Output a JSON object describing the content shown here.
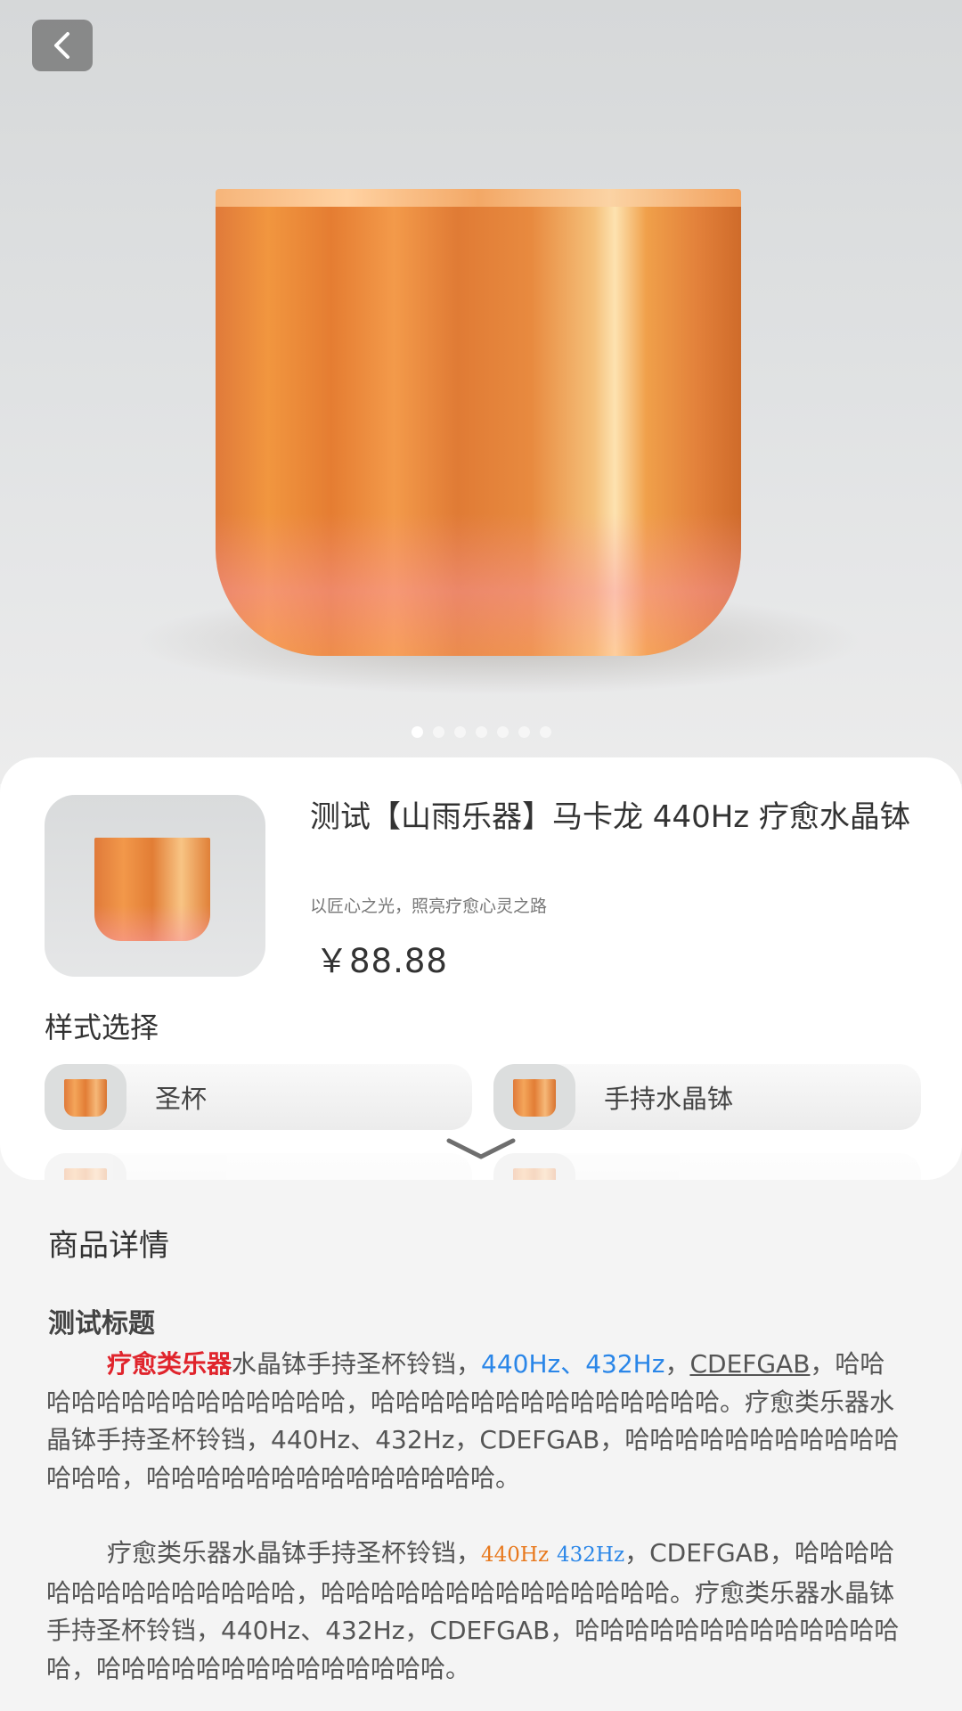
{
  "hero": {
    "image": "orange-crystal-singing-bowl",
    "carousel": {
      "count": 7,
      "active_index": 0
    }
  },
  "nav": {
    "back_icon": "chevron-left-icon"
  },
  "product": {
    "title": "测试【山雨乐器】马卡龙 440Hz 疗愈水晶钵",
    "subtitle": "以匠心之光，照亮疗愈心灵之路",
    "price": "￥88.88"
  },
  "styles": {
    "heading": "样式选择",
    "options": [
      {
        "label": "圣杯"
      },
      {
        "label": "手持水晶钵"
      }
    ],
    "expand_icon": "chevron-down-icon"
  },
  "details": {
    "heading": "商品详情",
    "title": "测试标题",
    "para1": {
      "red": "疗愈类乐器",
      "text1": "水晶钵手持圣杯铃铛，",
      "blue": "440Hz、432Hz",
      "sep": "，",
      "underline": "CDEFGAB",
      "text2": "，哈哈哈哈哈哈哈哈哈哈哈哈哈哈，哈哈哈哈哈哈哈哈哈哈哈哈哈哈。疗愈类乐器水晶钵手持圣杯铃铛，440Hz、432Hz，CDEFGAB，哈哈哈哈哈哈哈哈哈哈哈哈哈哈，哈哈哈哈哈哈哈哈哈哈哈哈哈哈。"
    },
    "para2": {
      "text1": "疗愈类乐器水晶钵手持圣杯铃铛，",
      "orange": "440Hz",
      "blue": "432Hz",
      "text2": "，CDEFGAB，哈哈哈哈哈哈哈哈哈哈哈哈哈哈，哈哈哈哈哈哈哈哈哈哈哈哈哈哈。疗愈类乐器水晶钵手持圣杯铃铛，440Hz、432Hz，CDEFGAB，哈哈哈哈哈哈哈哈哈哈哈哈哈哈，哈哈哈哈哈哈哈哈哈哈哈哈哈哈。"
    }
  }
}
